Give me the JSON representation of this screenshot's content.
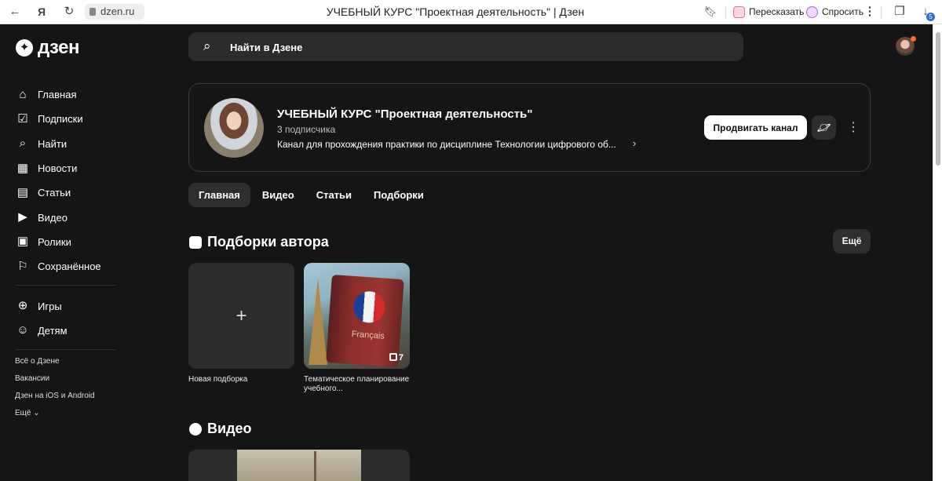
{
  "browser": {
    "url": "dzen.ru",
    "title": "УЧЕБНЫЙ КУРС \"Проектная деятельность\" | Дзен",
    "retell_label": "Пересказать",
    "ask_label": "Спросить",
    "downloads_badge": "5"
  },
  "logo": {
    "text": "дзен"
  },
  "sidebar": {
    "items": [
      {
        "label": "Главная",
        "icon": "home-icon"
      },
      {
        "label": "Подписки",
        "icon": "subscriptions-icon"
      },
      {
        "label": "Найти",
        "icon": "search-icon"
      },
      {
        "label": "Новости",
        "icon": "news-icon"
      },
      {
        "label": "Статьи",
        "icon": "articles-icon"
      },
      {
        "label": "Видео",
        "icon": "video-icon"
      },
      {
        "label": "Ролики",
        "icon": "shorts-icon"
      },
      {
        "label": "Сохранённое",
        "icon": "bookmark-icon"
      }
    ],
    "extra_items": [
      {
        "label": "Игры",
        "icon": "gamepad-icon"
      },
      {
        "label": "Детям",
        "icon": "kids-icon"
      }
    ],
    "footer": [
      "Всё о Дзене",
      "Вакансии",
      "Дзен на iOS и Android",
      "Ещё"
    ]
  },
  "search": {
    "placeholder": "Найти в Дзене"
  },
  "channel": {
    "name": "УЧЕБНЫЙ КУРС \"Проектная деятельность\"",
    "subscribers": "3 подписчика",
    "description": "Канал для прохождения практики по дисциплине Технологии цифрового об...",
    "promote_label": "Продвигать канал"
  },
  "tabs": [
    "Главная",
    "Видео",
    "Статьи",
    "Подборки"
  ],
  "collections": {
    "title": "Подборки автора",
    "more_label": "Ещё",
    "items": [
      {
        "label": "Новая подборка"
      },
      {
        "label": "Тематическое планирование учебного...",
        "count": "7",
        "book_word": "Français"
      }
    ]
  },
  "videos": {
    "title": "Видео"
  },
  "colors": {
    "background": "#151515",
    "card": "#2c2c2c",
    "accent_dot": "#ff6a2b"
  }
}
